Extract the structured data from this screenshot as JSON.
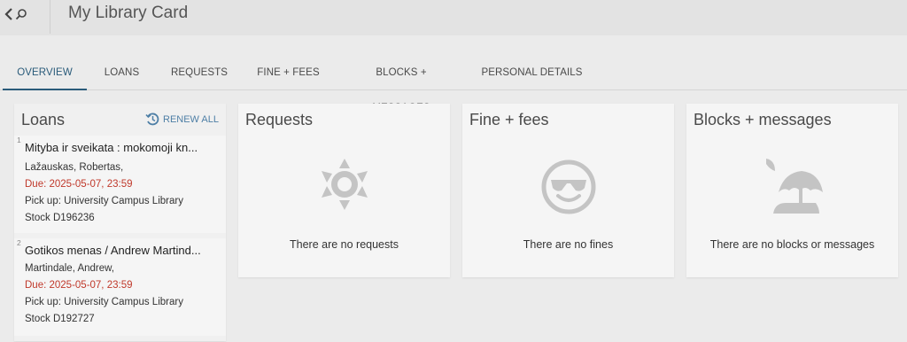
{
  "header": {
    "title": "My Library Card"
  },
  "tabs": [
    {
      "label": "OVERVIEW",
      "active": true
    },
    {
      "label": "LOANS",
      "active": false
    },
    {
      "label": "REQUESTS",
      "active": false
    },
    {
      "label": "FINE + FEES",
      "active": false
    },
    {
      "label": "BLOCKS + MESSAGES",
      "active": false
    },
    {
      "label": "PERSONAL DETAILS",
      "active": false
    }
  ],
  "loans": {
    "title": "Loans",
    "renew_all_label": "RENEW ALL",
    "items": [
      {
        "number": "1",
        "title": "Mityba ir sveikata : mokomoji kn...",
        "author": "Lažauskas, Robertas,",
        "due": "Due: 2025-05-07, 23:59",
        "pickup": "Pick up: University Campus Library",
        "stock": "Stock D196236"
      },
      {
        "number": "2",
        "title": "Gotikos menas / Andrew Martind...",
        "author": "Martindale, Andrew,",
        "due": "Due: 2025-05-07, 23:59",
        "pickup": "Pick up: University Campus Library",
        "stock": "Stock D192727"
      }
    ]
  },
  "requests": {
    "title": "Requests",
    "empty_text": "There are no requests",
    "icon": "sun-icon"
  },
  "fines": {
    "title": "Fine + fees",
    "empty_text": "There are no fines",
    "icon": "sunglasses-face-icon"
  },
  "blocks": {
    "title": "Blocks + messages",
    "empty_text": "There are no blocks or messages",
    "icon": "beach-umbrella-icon"
  },
  "colors": {
    "accent": "#2a5b7a",
    "link": "#4e7fa6",
    "due": "#c0392b",
    "icon_gray": "#c4c4c4"
  }
}
